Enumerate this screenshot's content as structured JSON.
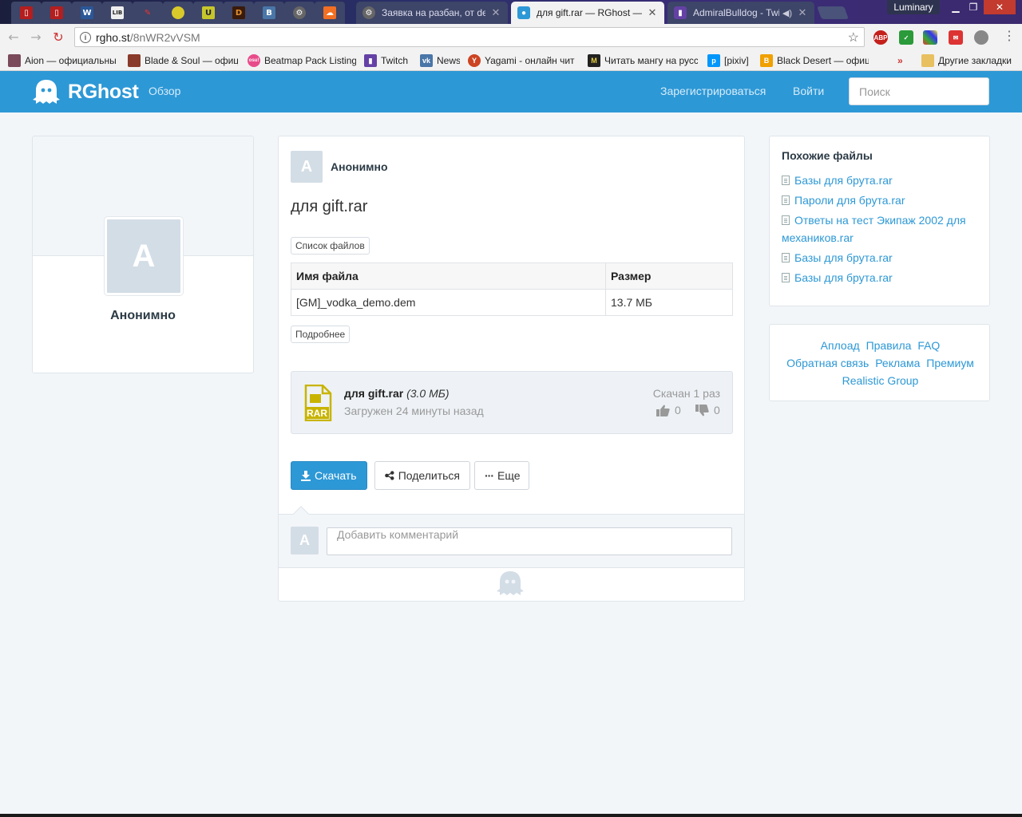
{
  "browser": {
    "tabs": [
      {
        "title": "Заявка на разбан, от der"
      },
      {
        "title": "для gift.rar — RGhost —"
      },
      {
        "title": "AdmiralBulldog - Twit"
      }
    ],
    "profile_name": "Luminary",
    "url_host": "rgho.st",
    "url_path": "/8nWR2vVSM",
    "bookmarks": [
      {
        "label": "Aion — официальны"
      },
      {
        "label": "Blade & Soul — офиц"
      },
      {
        "label": "Beatmap Pack Listing"
      },
      {
        "label": "Twitch"
      },
      {
        "label": "News"
      },
      {
        "label": "Yagami - онлайн чит"
      },
      {
        "label": "Читать мангу на русс"
      },
      {
        "label": "[pixiv]"
      },
      {
        "label": "Black Desert — офиц"
      }
    ],
    "other_bookmarks": "Другие закладки"
  },
  "site": {
    "brand": "RGhost",
    "nav_overview": "Обзор",
    "nav_register": "Зарегистрироваться",
    "nav_login": "Войти",
    "search_placeholder": "Поиск"
  },
  "user_panel": {
    "avatar_letter": "A",
    "name": "Анонимно"
  },
  "file": {
    "author_letter": "A",
    "author": "Анонимно",
    "title": "для gift.rar",
    "file_list_btn": "Список файлов",
    "table": {
      "col_name": "Имя файла",
      "col_size": "Размер",
      "rows": [
        {
          "name": "[GM]_vodka_demo.dem",
          "size": "13.7 МБ"
        }
      ]
    },
    "details_btn": "Подробнее",
    "info": {
      "name": "для gift.rar",
      "size": "(3.0 МБ)",
      "uploaded": "Загружен 24 минуты назад",
      "downloads": "Скачан 1 раз",
      "likes": "0",
      "dislikes": "0",
      "icon_label": "RAR"
    },
    "download_btn": "Скачать",
    "share_btn": "Поделиться",
    "more_btn": "Еще",
    "comment_letter": "A",
    "comment_placeholder": "Добавить комментарий"
  },
  "similar": {
    "title": "Похожие файлы",
    "items": [
      "Базы для брута.rar",
      "Пароли для брута.rar",
      "Ответы на тест Экипаж 2002 для механиков.rar",
      "Базы для брута.rar",
      "Базы для брута.rar"
    ]
  },
  "footer_links": {
    "upload": "Аплоад",
    "rules": "Правила",
    "faq": "FAQ",
    "feedback": "Обратная связь",
    "ads": "Реклама",
    "premium": "Премиум",
    "realistic": "Realistic Group"
  },
  "colors": {
    "brand_blue": "#2d98d6",
    "page_bg": "#f3f6f9",
    "rar_yellow": "#c8b400"
  }
}
